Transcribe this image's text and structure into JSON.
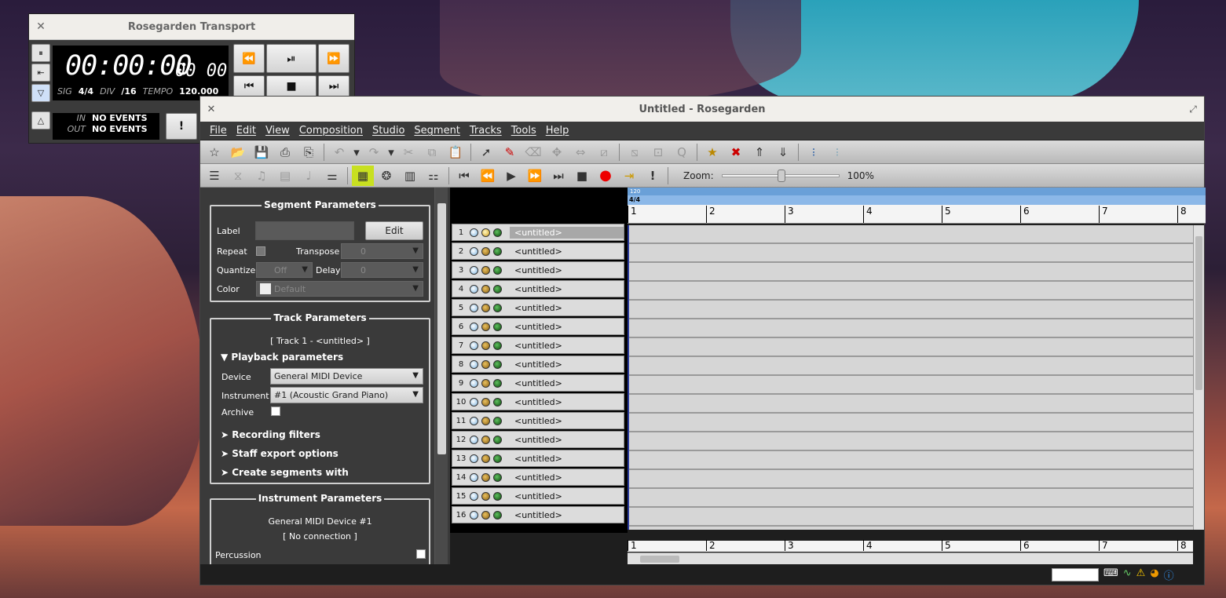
{
  "transport": {
    "title": "Rosegarden Transport",
    "time": "00:00:00",
    "time_ms": "00 00",
    "sig_label": "SIG",
    "sig_value": "4/4",
    "div_label": "DIV",
    "div_value": "/16",
    "tempo_label": "TEMPO",
    "tempo_value": "120.000",
    "in_label": "IN",
    "in_value": "NO EVENTS",
    "out_label": "OUT",
    "out_value": "NO EVENTS",
    "panic_label": "!"
  },
  "window": {
    "title": "Untitled - Rosegarden"
  },
  "menu": [
    "File",
    "Edit",
    "View",
    "Composition",
    "Studio",
    "Segment",
    "Tracks",
    "Tools",
    "Help"
  ],
  "zoom": {
    "label": "Zoom:",
    "value": "100%"
  },
  "segment_params": {
    "title": "Segment Parameters",
    "label_label": "Label",
    "edit_button": "Edit",
    "repeat_label": "Repeat",
    "transpose_label": "Transpose",
    "transpose_value": "0",
    "quantize_label": "Quantize",
    "quantize_value": "Off",
    "delay_label": "Delay",
    "delay_value": "0",
    "color_label": "Color",
    "color_value": "Default"
  },
  "track_params": {
    "title": "Track Parameters",
    "track_name": "[ Track 1 - <untitled> ]",
    "playback": "Playback parameters",
    "device_label": "Device",
    "device_value": "General MIDI Device",
    "instrument_label": "Instrument",
    "instrument_value": "#1 (Acoustic Grand Piano)",
    "archive_label": "Archive",
    "recording_filters": "Recording filters",
    "staff_export": "Staff export options",
    "create_segments": "Create segments with"
  },
  "instrument_params": {
    "title": "Instrument Parameters",
    "device": "General MIDI Device  #1",
    "connection": "[ No connection ]",
    "percussion_label": "Percussion"
  },
  "tracks": [
    {
      "n": "1",
      "label": "<untitled>"
    },
    {
      "n": "2",
      "label": "<untitled>"
    },
    {
      "n": "3",
      "label": "<untitled>"
    },
    {
      "n": "4",
      "label": "<untitled>"
    },
    {
      "n": "5",
      "label": "<untitled>"
    },
    {
      "n": "6",
      "label": "<untitled>"
    },
    {
      "n": "7",
      "label": "<untitled>"
    },
    {
      "n": "8",
      "label": "<untitled>"
    },
    {
      "n": "9",
      "label": "<untitled>"
    },
    {
      "n": "10",
      "label": "<untitled>"
    },
    {
      "n": "11",
      "label": "<untitled>"
    },
    {
      "n": "12",
      "label": "<untitled>"
    },
    {
      "n": "13",
      "label": "<untitled>"
    },
    {
      "n": "14",
      "label": "<untitled>"
    },
    {
      "n": "15",
      "label": "<untitled>"
    },
    {
      "n": "16",
      "label": "<untitled>"
    }
  ],
  "ruler": {
    "tempo": "120",
    "timesig": "4/4",
    "bars": [
      "1",
      "2",
      "3",
      "4",
      "5",
      "6",
      "7",
      "8"
    ]
  }
}
